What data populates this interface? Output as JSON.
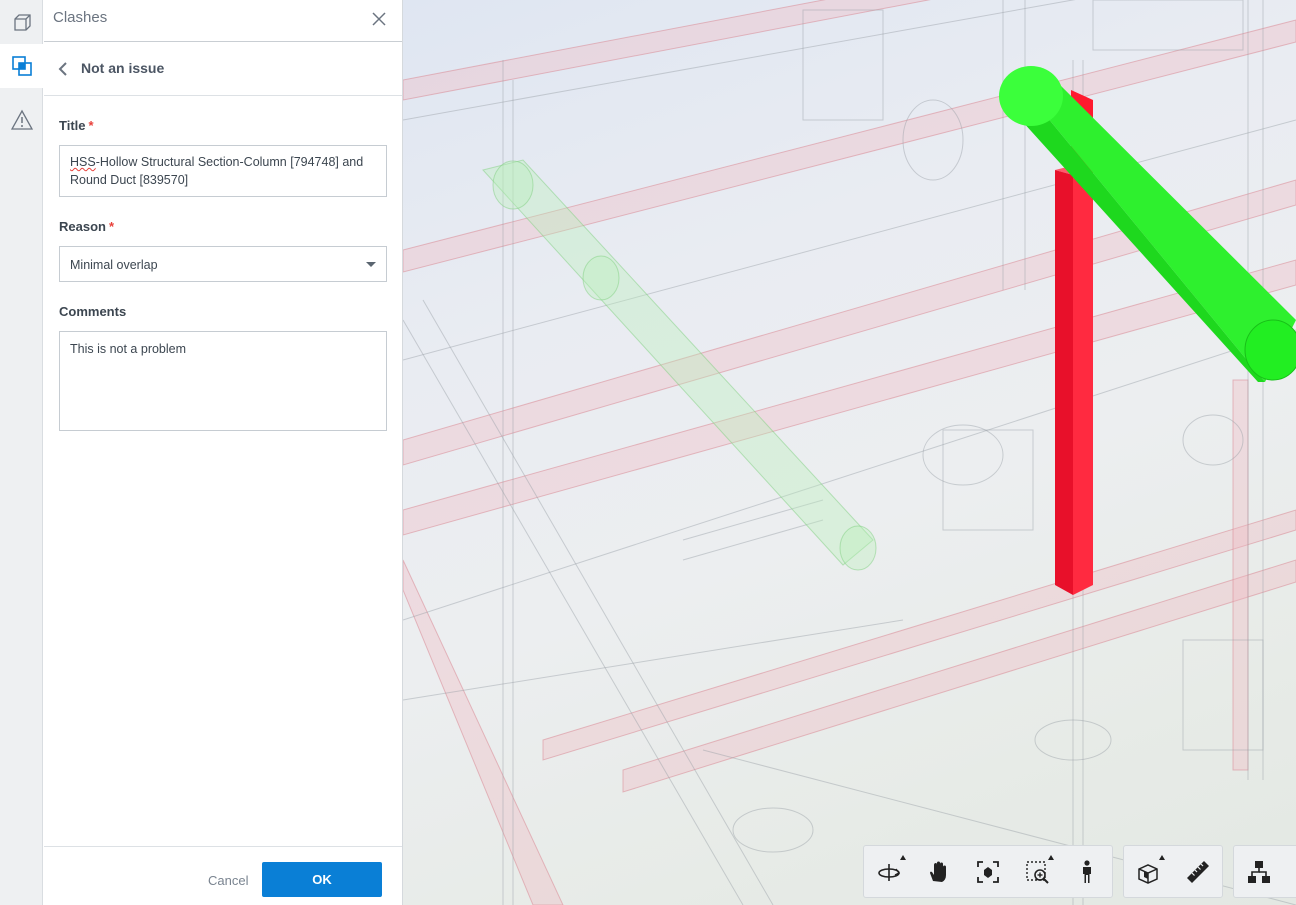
{
  "panel": {
    "title": "Clashes",
    "subheader": "Not an issue"
  },
  "form": {
    "title_label": "Title",
    "title_required": "*",
    "title_value_part1": "HSS",
    "title_value_part2": "-Hollow Structural Section-Column [794748] and Round Duct [839570]",
    "reason_label": "Reason",
    "reason_required": "*",
    "reason_value": "Minimal overlap",
    "comments_label": "Comments",
    "comments_value": "This is not a problem"
  },
  "footer": {
    "cancel_label": "Cancel",
    "ok_label": "OK"
  },
  "rail": {
    "items": [
      "model-browser-icon",
      "clashes-icon",
      "issues-warning-icon"
    ],
    "active": "clashes-icon"
  },
  "toolbar": {
    "groups": [
      [
        "orbit-icon",
        "pan-hand-icon",
        "fit-to-view-icon",
        "zoom-window-icon",
        "first-person-icon"
      ],
      [
        "section-box-icon",
        "measure-ruler-icon"
      ],
      [
        "model-tree-icon"
      ]
    ]
  },
  "colors": {
    "accent": "#0a7fd6",
    "required": "#e8403a",
    "clash_column": "#ff1a2e",
    "clash_duct": "#22ee22"
  }
}
